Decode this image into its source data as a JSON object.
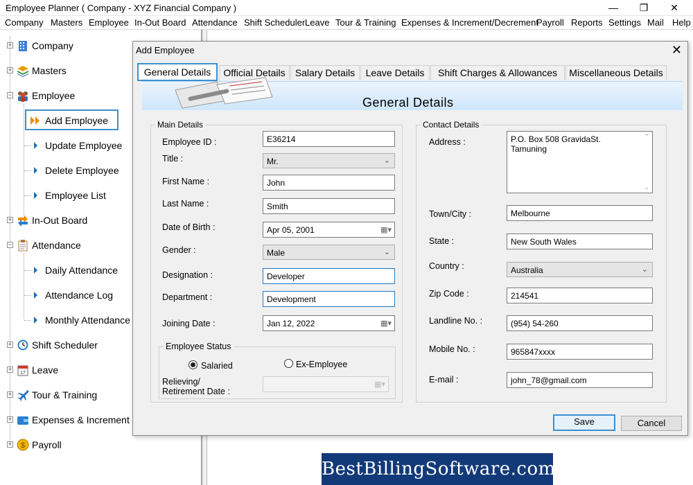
{
  "window": {
    "title": "Employee Planner ( Company - XYZ Financial Company )"
  },
  "menu": [
    "Company",
    "Masters",
    "Employee",
    "In-Out Board",
    "Attendance",
    "Shift Scheduler",
    "Leave",
    "Tour & Training",
    "Expenses & Increment/Decrement",
    "Payroll",
    "Reports",
    "Settings",
    "Mail",
    "Help"
  ],
  "tree": {
    "company": "Company",
    "masters": "Masters",
    "employee": "Employee",
    "add_employee": "Add Employee",
    "update_employee": "Update Employee",
    "delete_employee": "Delete Employee",
    "employee_list": "Employee List",
    "inout": "In-Out Board",
    "attendance": "Attendance",
    "daily_attendance": "Daily Attendance",
    "attendance_log": "Attendance Log",
    "monthly_attendance": "Monthly Attendance",
    "shift_scheduler": "Shift Scheduler",
    "leave": "Leave",
    "tour_training": "Tour & Training",
    "expenses": "Expenses & Increment",
    "payroll": "Payroll"
  },
  "dialog": {
    "title": "Add Employee",
    "tabs": [
      "General Details",
      "Official Details",
      "Salary Details",
      "Leave Details",
      "Shift Charges & Allowances",
      "Miscellaneous Details"
    ],
    "banner_title": "General Details",
    "main_details": {
      "legend": "Main Details",
      "employee_id_label": "Employee ID :",
      "employee_id": "E36214",
      "title_label": "Title :",
      "title": "Mr.",
      "first_name_label": "First Name :",
      "first_name": "John",
      "last_name_label": "Last Name :",
      "last_name": "Smith",
      "dob_label": "Date of Birth :",
      "dob": "Apr 05, 2001",
      "gender_label": "Gender :",
      "gender": "Male",
      "designation_label": "Designation :",
      "designation": "Developer",
      "department_label": "Department :",
      "department": "Development",
      "joining_label": "Joining Date :",
      "joining": "Jan 12, 2022"
    },
    "status": {
      "legend": "Employee Status",
      "salaried": "Salaried",
      "ex_employee": "Ex-Employee",
      "relieving_label_1": "Relieving/",
      "relieving_label_2": "Retirement Date :"
    },
    "contact": {
      "legend": "Contact Details",
      "address_label": "Address :",
      "address_line1": "P.O. Box 508 GravidaSt.",
      "address_line2": "Tamuning",
      "town_label": "Town/City :",
      "town": "Melbourne",
      "state_label": "State :",
      "state": "New South Wales",
      "country_label": "Country :",
      "country": "Australia",
      "zip_label": "Zip Code :",
      "zip": "214541",
      "landline_label": "Landline No. :",
      "landline": "(954) 54-260",
      "mobile_label": "Mobile No. :",
      "mobile": "965847xxxx",
      "email_label": "E-mail :",
      "email": "john_78@gmail.com"
    },
    "buttons": {
      "save": "Save",
      "cancel": "Cancel"
    }
  },
  "watermark": "BestBillingSoftware.com"
}
